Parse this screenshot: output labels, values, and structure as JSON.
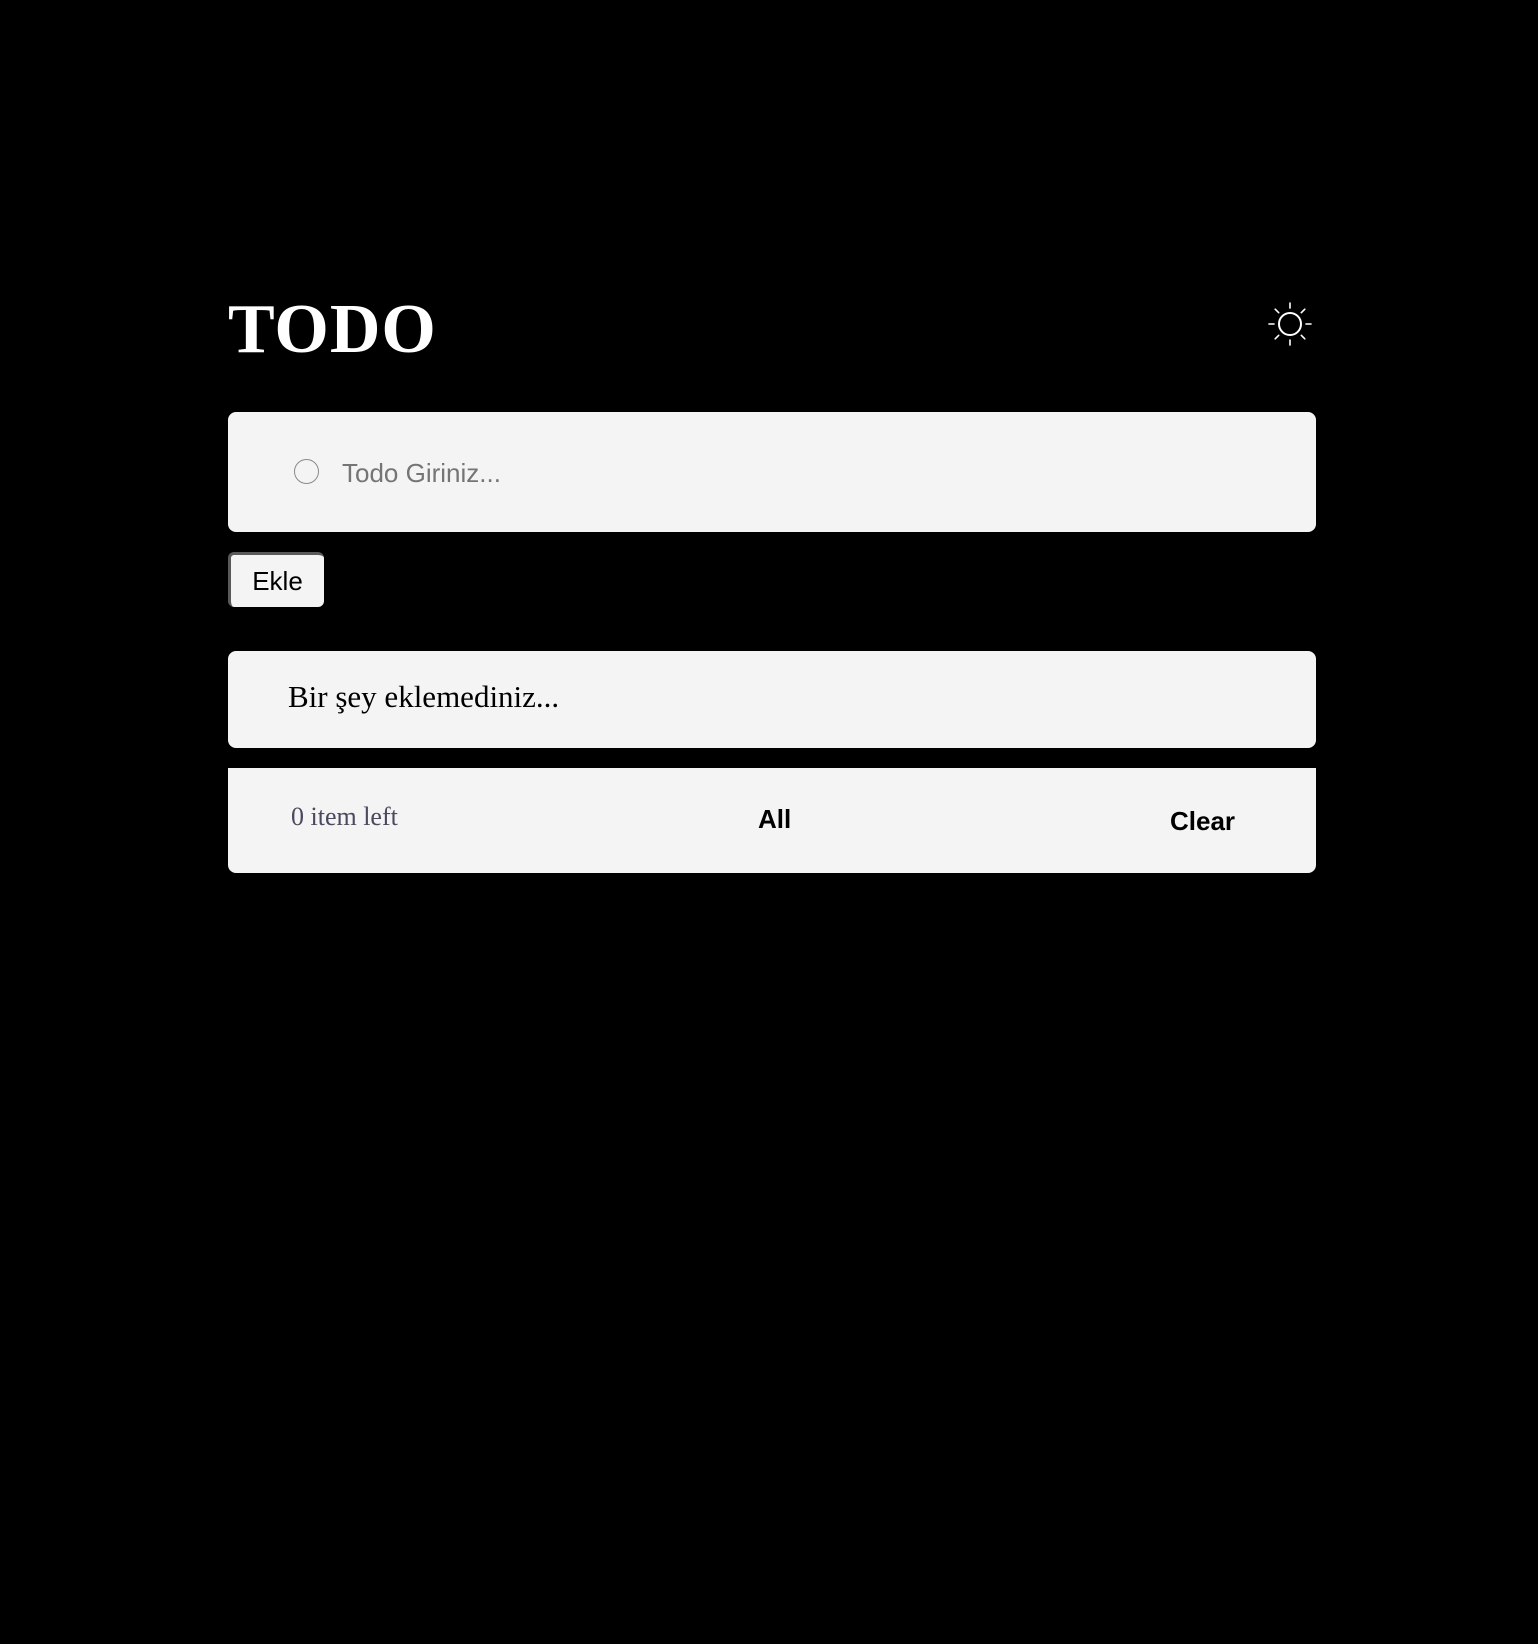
{
  "header": {
    "title": "TODO",
    "theme_icon": "sun-icon"
  },
  "input": {
    "placeholder": "Todo Giriniz...",
    "value": "",
    "checkbox_icon": "circle-icon"
  },
  "add_button": {
    "label": "Ekle"
  },
  "list": {
    "empty_message": "Bir şey eklemediniz..."
  },
  "footer": {
    "items_left": "0 item left",
    "filter_all": "All",
    "clear": "Clear"
  },
  "colors": {
    "background": "#000000",
    "panel": "#f4f4f4",
    "title": "#ffffff",
    "muted_text": "#4a4a5e"
  }
}
